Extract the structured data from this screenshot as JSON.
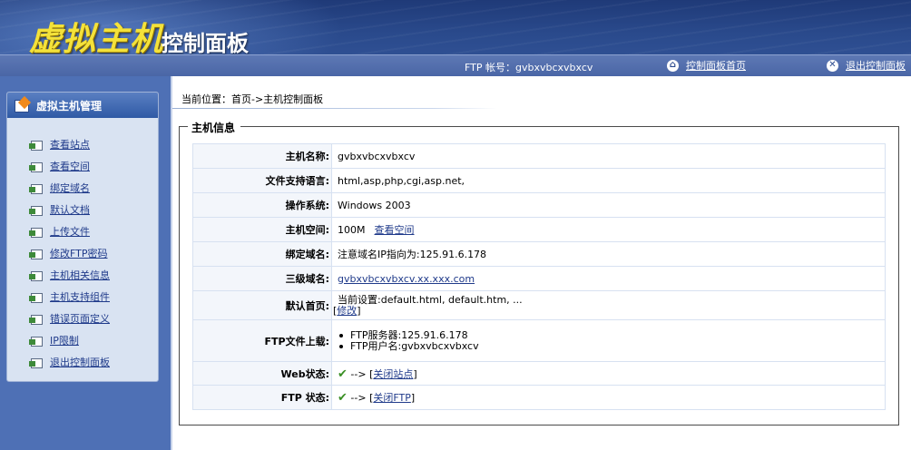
{
  "header": {
    "title_main": "虚拟主机",
    "title_sub": "控制面板",
    "ftp_account_label": "FTP 帐号：",
    "ftp_account_value": "gvbxvbcxvbxcv",
    "home_link": "控制面板首页",
    "exit_link": "退出控制面板"
  },
  "sidebar": {
    "title": "虚拟主机管理",
    "items": [
      {
        "label": "查看站点"
      },
      {
        "label": "查看空间"
      },
      {
        "label": "绑定域名"
      },
      {
        "label": "默认文档"
      },
      {
        "label": "上传文件"
      },
      {
        "label": "修改FTP密码"
      },
      {
        "label": "主机相关信息"
      },
      {
        "label": "主机支持组件"
      },
      {
        "label": "错误页面定义"
      },
      {
        "label": "IP限制"
      },
      {
        "label": "退出控制面板"
      }
    ]
  },
  "breadcrumb": "当前位置：首页->主机控制面板",
  "section_title": "主机信息",
  "info": {
    "host_name": {
      "label": "主机名称:",
      "value": "gvbxvbcxvbxcv"
    },
    "languages": {
      "label": "文件支持语言:",
      "value": "html,asp,php,cgi,asp.net,"
    },
    "os": {
      "label": "操作系统:",
      "value": "Windows 2003"
    },
    "space": {
      "label": "主机空间:",
      "value": "100M",
      "link": "查看空间"
    },
    "bind_domain": {
      "label": "绑定域名:",
      "value": "注意域名IP指向为:125.91.6.178"
    },
    "third_domain": {
      "label": "三级域名:",
      "value": "gvbxvbcxvbxcv.xx.xxx.com"
    },
    "default_page": {
      "label": "默认首页:",
      "value": "当前设置:default.html, default.htm, ...",
      "modify_prefix": "[",
      "modify_link": "修改",
      "modify_suffix": "]"
    },
    "ftp_upload": {
      "label": "FTP文件上载:",
      "server": "FTP服务器:125.91.6.178",
      "user": "FTP用户名:gvbxvbcxvbxcv"
    },
    "web_status": {
      "label": "Web状态:",
      "arrow": "--> ",
      "open": "[",
      "link": "关闭站点",
      "close": "]"
    },
    "ftp_status": {
      "label": "FTP 状态:",
      "arrow": "--> ",
      "open": "[",
      "link": "关闭FTP",
      "close": "]"
    }
  },
  "icons": {
    "home": "home-icon",
    "exit": "close-circle-icon",
    "menu_header": "folder-icon",
    "menu_item": "page-icon",
    "status_ok": "check-icon"
  },
  "colors": {
    "header_bg": "#2a4a8c",
    "title_yellow": "#f4e23a",
    "link": "#1f3a8a",
    "check": "#3a8f24",
    "sidebar_bg": "#4e70b5"
  }
}
